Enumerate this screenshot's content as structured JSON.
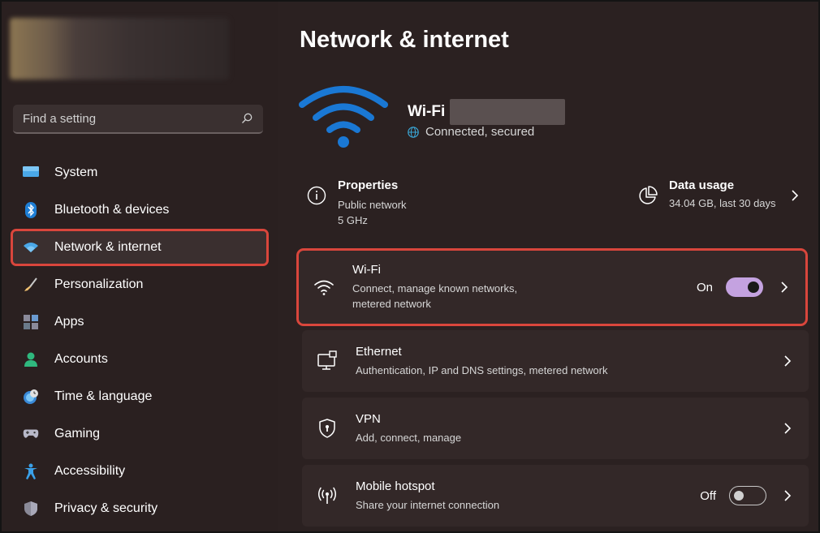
{
  "search": {
    "placeholder": "Find a setting"
  },
  "sidebar": {
    "items": [
      {
        "label": "System",
        "icon": "system-icon"
      },
      {
        "label": "Bluetooth & devices",
        "icon": "bluetooth-icon"
      },
      {
        "label": "Network & internet",
        "icon": "network-icon",
        "selected": true
      },
      {
        "label": "Personalization",
        "icon": "brush-icon"
      },
      {
        "label": "Apps",
        "icon": "apps-icon"
      },
      {
        "label": "Accounts",
        "icon": "accounts-icon"
      },
      {
        "label": "Time & language",
        "icon": "clock-globe-icon"
      },
      {
        "label": "Gaming",
        "icon": "gamepad-icon"
      },
      {
        "label": "Accessibility",
        "icon": "accessibility-icon"
      },
      {
        "label": "Privacy & security",
        "icon": "shield-icon"
      }
    ]
  },
  "main": {
    "title": "Network & internet",
    "connection": {
      "name": "Wi-Fi",
      "status": "Connected, secured"
    },
    "properties": {
      "title": "Properties",
      "line1": "Public network",
      "line2": "5 GHz"
    },
    "data_usage": {
      "title": "Data usage",
      "value": "34.04 GB, last 30 days"
    },
    "cards": {
      "wifi": {
        "title": "Wi-Fi",
        "sub": "Connect, manage known networks, metered network",
        "state": "On"
      },
      "ethernet": {
        "title": "Ethernet",
        "sub": "Authentication, IP and DNS settings, metered network"
      },
      "vpn": {
        "title": "VPN",
        "sub": "Add, connect, manage"
      },
      "hotspot": {
        "title": "Mobile hotspot",
        "sub": "Share your internet connection",
        "state": "Off"
      }
    }
  },
  "colors": {
    "accent": "#1a78d4",
    "highlight": "#d9463c",
    "toggle_on": "#c4a2e0",
    "background": "#2b2121"
  }
}
